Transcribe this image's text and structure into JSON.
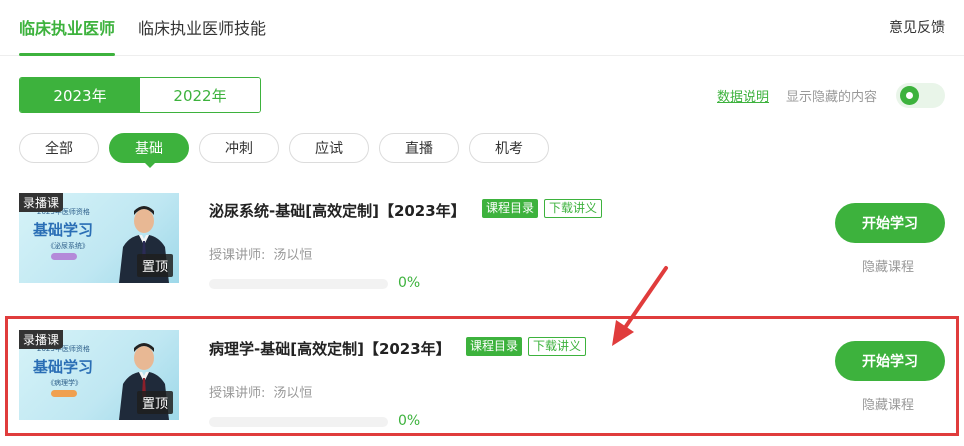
{
  "nav": {
    "tabs": [
      {
        "label": "临床执业医师",
        "active": true
      },
      {
        "label": "临床执业医师技能",
        "active": false
      }
    ],
    "feedback": "意见反馈"
  },
  "years": [
    {
      "label": "2023年",
      "active": true
    },
    {
      "label": "2022年",
      "active": false
    }
  ],
  "options": {
    "data_note": "数据说明",
    "show_hidden": "显示隐藏的内容",
    "toggle_on": true
  },
  "filters": [
    {
      "label": "全部",
      "active": false
    },
    {
      "label": "基础",
      "active": true
    },
    {
      "label": "冲刺",
      "active": false
    },
    {
      "label": "应试",
      "active": false
    },
    {
      "label": "直播",
      "active": false
    },
    {
      "label": "机考",
      "active": false
    }
  ],
  "courses": [
    {
      "tag": "录播课",
      "thumb_sub": "2023年医师资格",
      "thumb_title": "基础学习",
      "thumb_subject": "《泌尿系统》",
      "pin": "置顶",
      "title": "泌尿系统-基础[高效定制]【2023年】",
      "catalog": "课程目录",
      "download": "下载讲义",
      "teacher_label": "授课讲师:",
      "teacher": "汤以恒",
      "progress": 0,
      "progress_text": "0%",
      "start": "开始学习",
      "hide": "隐藏课程"
    },
    {
      "tag": "录播课",
      "thumb_sub": "2023年医师资格",
      "thumb_title": "基础学习",
      "thumb_subject": "《病理学》",
      "pin": "置顶",
      "title": "病理学-基础[高效定制]【2023年】",
      "catalog": "课程目录",
      "download": "下载讲义",
      "teacher_label": "授课讲师:",
      "teacher": "汤以恒",
      "progress": 0,
      "progress_text": "0%",
      "start": "开始学习",
      "hide": "隐藏课程"
    }
  ],
  "colors": {
    "accent": "#3db23d",
    "highlight": "#e03c3c"
  }
}
